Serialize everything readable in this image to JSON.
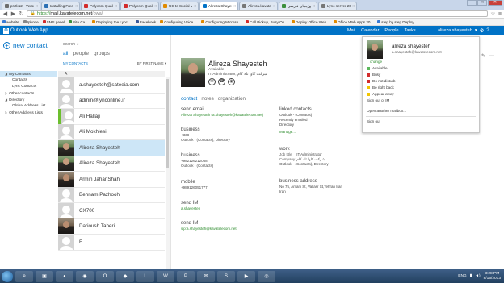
{
  "browser": {
    "tabs": [
      {
        "label": "ps2k12 - Verso",
        "color": "#6d6d6d"
      },
      {
        "label": "Installing FreePBX",
        "color": "#2b6fb4"
      },
      {
        "label": "Polycom Quali...",
        "color": "#d22b2b"
      },
      {
        "label": "Polycom Quali...",
        "color": "#d22b2b"
      },
      {
        "label": "UC to Social Med...",
        "color": "#e08a00"
      },
      {
        "label": "Alireza Shayesteh",
        "color": "#0072c6"
      },
      {
        "label": "Alireza.kavatele...",
        "color": "#777777"
      },
      {
        "label": "پروژه‌های فارسی",
        "color": "#3c8f3c"
      },
      {
        "label": "Lync server 20...",
        "color": "#777777"
      }
    ],
    "active_tab_index": 5,
    "window_buttons": [
      "‒",
      "□",
      "✕"
    ],
    "url": {
      "scheme": "https://",
      "host": "mail.kavatelecom.net",
      "path": "/owa/"
    },
    "bookmarks": [
      {
        "label": "website",
        "color": "#3a7bd5"
      },
      {
        "label": "Iphone",
        "color": "#888888"
      },
      {
        "label": "SMS panel",
        "color": "#d22b2b"
      },
      {
        "label": "Site Ca...",
        "color": "#3c8f3c"
      },
      {
        "label": "Deploying the Lync ...",
        "color": "#e08a00"
      },
      {
        "label": "Facebook",
        "color": "#3b5998"
      },
      {
        "label": "Configuring Voice ...",
        "color": "#e08a00"
      },
      {
        "label": "Configuring Microso...",
        "color": "#e08a00"
      },
      {
        "label": "Call Pickup, Busy On...",
        "color": "#d22b2b"
      },
      {
        "label": "Deploy Office Web...",
        "color": "#e08a00"
      },
      {
        "label": "Office Web Apps 20...",
        "color": "#e08a00"
      },
      {
        "label": "step by step Deploy ...",
        "color": "#3a7bd5"
      }
    ]
  },
  "owa": {
    "app_name": "Outlook Web App",
    "nav": [
      "Mail",
      "Calendar",
      "People",
      "Tasks"
    ],
    "user": "alireza shayesteh",
    "accent": "#0072c6"
  },
  "leftnav": {
    "new_contact": "new contact",
    "tree": [
      {
        "label": "My Contacts",
        "level": 0,
        "selected": true,
        "arrow": "◢"
      },
      {
        "label": "Contacts",
        "level": 1,
        "selected": false,
        "arrow": ""
      },
      {
        "label": "Lync Contacts",
        "level": 1,
        "selected": false,
        "arrow": ""
      },
      {
        "label": "Other contacts",
        "level": 0,
        "selected": false,
        "arrow": "▷"
      },
      {
        "label": "Directory",
        "level": 0,
        "selected": false,
        "arrow": "◢"
      },
      {
        "label": "Global Address List",
        "level": 1,
        "selected": false,
        "arrow": ""
      },
      {
        "label": "Other Address Lists",
        "level": 0,
        "selected": false,
        "arrow": "▷"
      }
    ]
  },
  "list": {
    "search_label": "search",
    "filters": [
      "all",
      "people",
      "groups"
    ],
    "active_filter": 0,
    "header_left": "MY CONTACTS",
    "header_right": "BY FIRST NAME ▾",
    "letter": "A",
    "contacts": [
      {
        "name": "a.shayesteh@sateeia.com",
        "avatar": "blank",
        "selected": false
      },
      {
        "name": "admin@lynconline.ir",
        "avatar": "blank",
        "selected": false
      },
      {
        "name": "Ali Hallaji",
        "avatar": "blank-bar",
        "selected": false
      },
      {
        "name": "Ali Mokhlesi",
        "avatar": "blank",
        "selected": false
      },
      {
        "name": "Alireza Shayesteh",
        "avatar": "photo",
        "selected": true
      },
      {
        "name": "Alireza Shayesteh",
        "avatar": "photo",
        "selected": false
      },
      {
        "name": "Armin JahanShahi",
        "avatar": "photo2",
        "selected": false
      },
      {
        "name": "Behnam Pazhoohi",
        "avatar": "blank",
        "selected": false
      },
      {
        "name": "CX700",
        "avatar": "blank",
        "selected": false
      },
      {
        "name": "Darioush Taheri",
        "avatar": "photo2",
        "selected": false
      },
      {
        "name": "E",
        "avatar": "blank",
        "selected": false
      }
    ]
  },
  "detail": {
    "name": "Alireza Shayesteh",
    "status": "Available",
    "title": "IT Administrator, شرکت کاوا تله کام",
    "actions": [
      "✉",
      "☎",
      "◉"
    ],
    "tabs": [
      "contact",
      "notes",
      "organization"
    ],
    "active_tab": 0,
    "send_email_label": "send email",
    "send_email_value": "Alireza Shayesteh (a.shayesteh@kavatelecom.net)",
    "business1_label": "business",
    "business1_value": "+338",
    "business1_source": "Outlook - (Contacts), Directory",
    "business2_label": "business",
    "business2_value": "+982126212058",
    "business2_source": "Outlook - (Contacts)",
    "mobile_label": "mobile",
    "mobile_value": "+989126051777",
    "im1_label": "send IM",
    "im1_value": "a.shayesteh",
    "im2_label": "send IM",
    "im2_value": "sip:a.shayesteh@kavatelecom.net",
    "linked_label": "linked contacts",
    "linked_items": [
      "Outlook - (Contacts)",
      "Recently emailed",
      "Directory"
    ],
    "manage_link": "Manage...",
    "work_label": "work",
    "job_title_key": "Job title",
    "job_title_value": "IT Administrator",
    "company_key": "Company",
    "company_value": "شرکت کاوا تله کام",
    "work_source": "Outlook - (Contacts), Directory",
    "address_label": "business address",
    "address_line1": "No 75, Amani St, Valiasr St,Tehran Iran",
    "address_line2": "Iran"
  },
  "presence": {
    "name": "alireza shayesteh",
    "email": "a.shayesteh@kavatelecom.net",
    "change": "change",
    "options": [
      {
        "label": "Available",
        "color": "#5cb85c"
      },
      {
        "label": "Busy",
        "color": "#d22b2b"
      },
      {
        "label": "Do not disturb",
        "color": "#d22b2b"
      },
      {
        "label": "Be right back",
        "color": "#f2c500"
      },
      {
        "label": "Appear away",
        "color": "#f2c500"
      }
    ],
    "sign_out_im": "Sign out of IM",
    "another_mailbox": "Open another mailbox...",
    "sign_out": "Sign out"
  },
  "taskbar": {
    "apps": [
      "e",
      "▣",
      "◐",
      "◉",
      "O",
      "◆",
      "L",
      "W",
      "P",
      "✉",
      "S",
      "▶",
      "◎"
    ],
    "lang": "ENG",
    "time": "3:28 PM",
    "date": "8/15/2013"
  }
}
